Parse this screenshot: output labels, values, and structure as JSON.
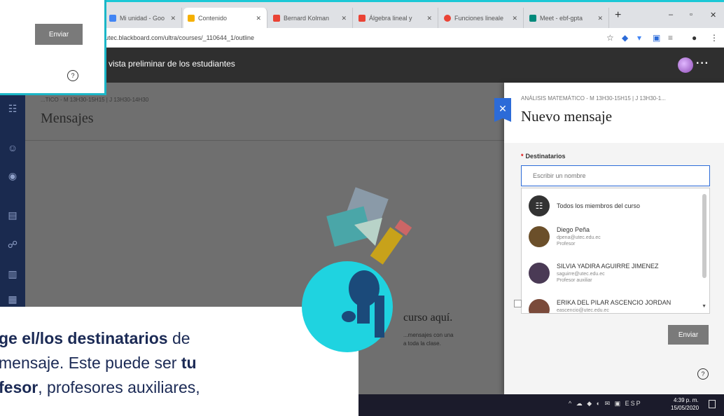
{
  "browser": {
    "tabs": [
      {
        "label": "Mi unidad - Goo",
        "icon_color": "#4285f4",
        "active": false
      },
      {
        "label": "Contenido",
        "icon_color": "#f5b000",
        "active": true
      },
      {
        "label": "Bernard Kolman",
        "icon_color": "#ea4335",
        "active": false
      },
      {
        "label": "Álgebra lineal y",
        "icon_color": "#ea4335",
        "active": false
      },
      {
        "label": "Funciones lineale",
        "icon_color": "#ea4335",
        "active": false
      },
      {
        "label": "Meet - ebf-gpta",
        "icon_color": "#00897b",
        "active": false
      }
    ],
    "new_tab": "+",
    "url": "utec.blackboard.com/ultra/courses/_110644_1/outline",
    "window_controls": [
      "–",
      "▫",
      "✕"
    ],
    "toolbar_icons": [
      "star-icon",
      "extension-icon",
      "puzzle-icon",
      "profile-icon"
    ]
  },
  "bb_header": {
    "preview_text": "vista preliminar de los estudiantes",
    "more": "···"
  },
  "main": {
    "course_line": "...TICO - M 13H30-15H15 | J 13H30-14H30",
    "title": "Mensajes",
    "empty_title": "curso aquí.",
    "empty_line1": "...mensajes con una",
    "empty_line2": "a toda la clase."
  },
  "panel": {
    "course_line": "ANÁLISIS MATEMÁTICO - M 13H30-15H15 | J 13H30-1...",
    "title": "Nuevo mensaje",
    "recipients_label": "Destinatarios",
    "required_mark": "*",
    "recipients_placeholder": "Escribir un nombre",
    "options": [
      {
        "name": "Todos los miembros del curso",
        "email": "",
        "role": "",
        "avatar": "#333333"
      },
      {
        "name": "Diego Peña",
        "email": "dpena@utec.edu.ec",
        "role": "Profesor",
        "avatar": "#6b4f2a"
      },
      {
        "name": "SILVIA YADIRA AGUIRRE JIMENEZ",
        "email": "saguirre@utec.edu.ec",
        "role": "Profesor auxiliar",
        "avatar": "#4a3a55"
      },
      {
        "name": "ERIKA DEL PILAR ASCENCIO JORDAN",
        "email": "eascencio@utec.edu.ec",
        "role": "",
        "avatar": "#7a4a3a"
      }
    ],
    "send_label": "Enviar",
    "help_icon": "?"
  },
  "popup": {
    "send_label": "Enviar",
    "help_icon": "?"
  },
  "taskbar": {
    "tray": "^ ☁ ◆ ◐ ✉ ▣ ESP",
    "time": "4:39 p. m.",
    "date": "15/05/2020"
  },
  "caption": {
    "part1": "ge el/los destinatarios",
    "part2": " de",
    "part3": "mensaje. Este puede ser ",
    "part4": "tu",
    "part5": "fesor",
    "part6": ", profesores auxiliares,"
  },
  "colors": {
    "accent": "#1bc8d6",
    "nav": "#1a2a4f",
    "primary_blue": "#2c6bd8",
    "caption_text": "#1b2a55"
  }
}
